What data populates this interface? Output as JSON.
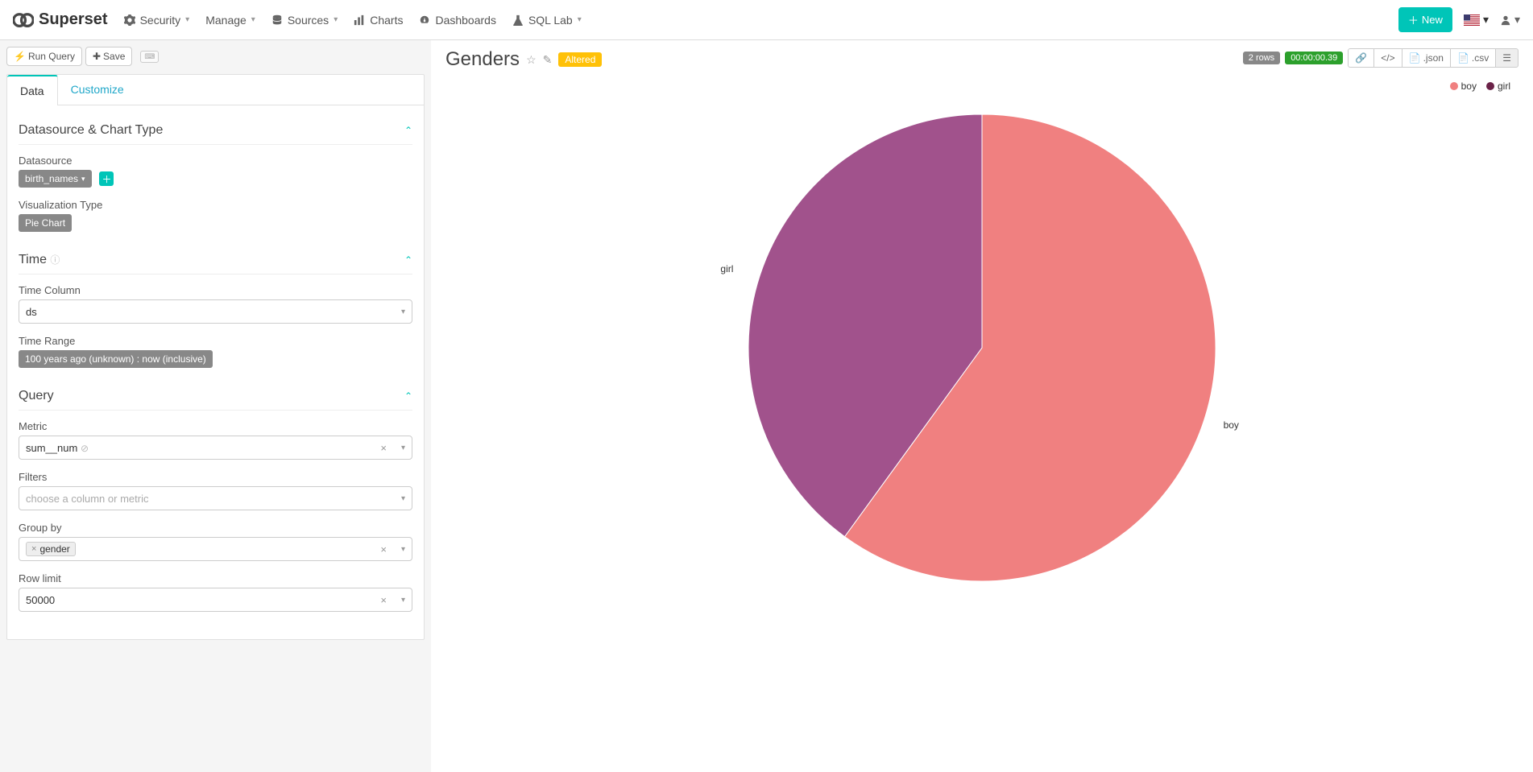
{
  "brand": "Superset",
  "nav": {
    "security": "Security",
    "manage": "Manage",
    "sources": "Sources",
    "charts": "Charts",
    "dashboards": "Dashboards",
    "sqllab": "SQL Lab"
  },
  "new_button": "New",
  "top_buttons": {
    "run_query": "Run Query",
    "save": "Save"
  },
  "tabs": {
    "data": "Data",
    "customize": "Customize"
  },
  "sections": {
    "ds_chart": {
      "title": "Datasource & Chart Type",
      "datasource_label": "Datasource",
      "datasource_value": "birth_names",
      "viz_label": "Visualization Type",
      "viz_value": "Pie Chart"
    },
    "time": {
      "title": "Time",
      "time_col_label": "Time Column",
      "time_col_value": "ds",
      "time_range_label": "Time Range",
      "time_range_value": "100 years ago (unknown) : now (inclusive)"
    },
    "query": {
      "title": "Query",
      "metric_label": "Metric",
      "metric_value": "sum__num",
      "filters_label": "Filters",
      "filters_placeholder": "choose a column or metric",
      "groupby_label": "Group by",
      "groupby_value": "gender",
      "rowlimit_label": "Row limit",
      "rowlimit_value": "50000"
    }
  },
  "chart": {
    "title": "Genders",
    "altered": "Altered",
    "rows": "2 rows",
    "duration": "00:00:00.39",
    "export_json": ".json",
    "export_csv": ".csv"
  },
  "chart_data": {
    "type": "pie",
    "title": "Genders",
    "series": [
      {
        "name": "boy",
        "value": 60,
        "color": "#f08080"
      },
      {
        "name": "girl",
        "value": 40,
        "color": "#a1528c"
      }
    ]
  }
}
